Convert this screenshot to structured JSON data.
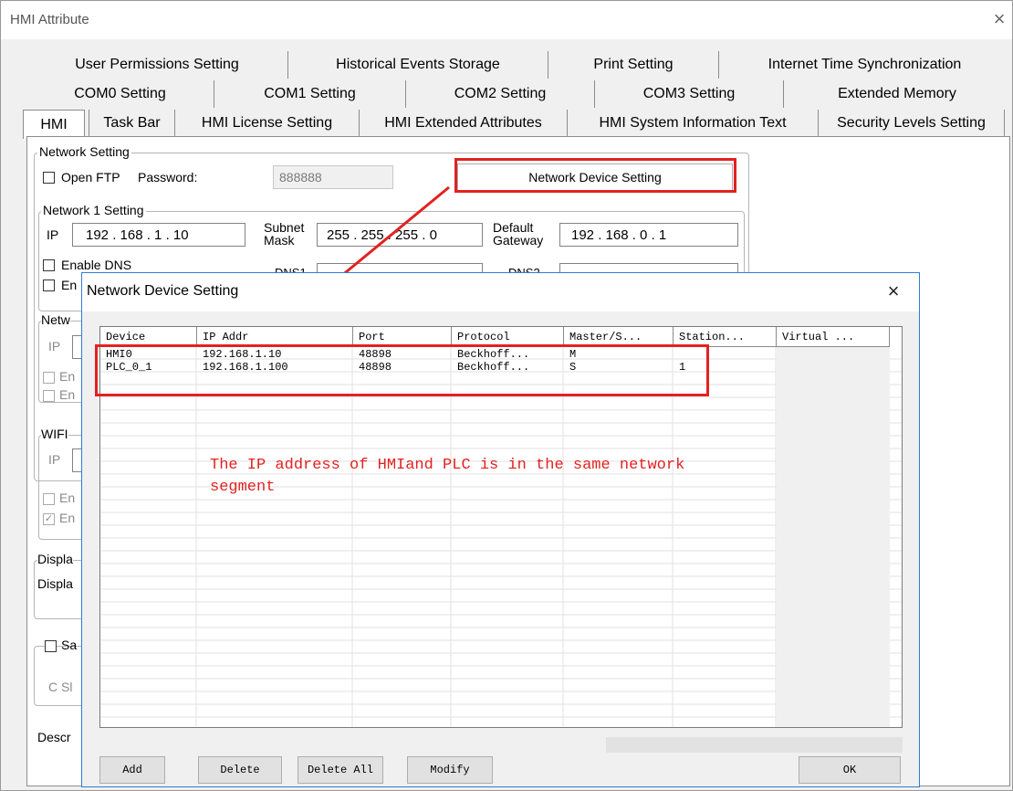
{
  "window": {
    "title": "HMI Attribute",
    "close_glyph": "×"
  },
  "tabs": {
    "row1": [
      "User Permissions Setting",
      "Historical Events Storage",
      "Print Setting",
      "Internet Time Synchronization"
    ],
    "row2": [
      "COM0 Setting",
      "COM1 Setting",
      "COM2 Setting",
      "COM3 Setting",
      "Extended Memory"
    ],
    "row3": [
      "HMI",
      "Task Bar",
      "HMI License Setting",
      "HMI Extended Attributes",
      "HMI System Information Text",
      "Security Levels Setting"
    ],
    "active": "HMI"
  },
  "network_setting": {
    "group_label": "Network Setting",
    "open_ftp_label": "Open FTP",
    "password_label": "Password:",
    "password_value": "888888",
    "network_device_button": "Network Device Setting"
  },
  "network1": {
    "group_label": "Network 1 Setting",
    "ip_label": "IP",
    "ip_value": "192 . 168 .  1  . 10",
    "subnet_label": "Subnet Mask",
    "subnet_value": "255 . 255 . 255 .  0",
    "gateway_label": "Default Gateway",
    "gateway_value": "192 . 168 .  0  .  1",
    "enable_dns_label": "Enable DNS",
    "dns1_label": "DNS1",
    "dns2_label": "DNS2",
    "en_label": "En"
  },
  "partial_labels": {
    "netw": "Netw",
    "ip": "IP",
    "en": "En",
    "wifi": "WIFI",
    "displa": "Displa",
    "sa": "Sa",
    "radio_s": "C  Sl",
    "descr": "Descr"
  },
  "dialog": {
    "title": "Network Device Setting",
    "close_glyph": "×",
    "columns": [
      "Device",
      "IP Addr",
      "Port",
      "Protocol",
      "Master/S...",
      "Station...",
      "Virtual ..."
    ],
    "rows": [
      [
        "HMI0",
        "192.168.1.10",
        "48898",
        "Beckhoff...",
        "M",
        ""
      ],
      [
        "PLC_0_1",
        "192.168.1.100",
        "48898",
        "Beckhoff...",
        "S",
        "1"
      ]
    ],
    "annotation_line1": "The IP address of HMIand PLC is in the same network",
    "annotation_line2": "segment",
    "buttons": {
      "add": "Add",
      "delete": "Delete",
      "delete_all": "Delete All",
      "modify": "Modify",
      "ok": "OK"
    }
  },
  "colors": {
    "highlight": "#e32121",
    "annotation_text": "#e32121",
    "dialog_border": "#2f7dd6"
  }
}
